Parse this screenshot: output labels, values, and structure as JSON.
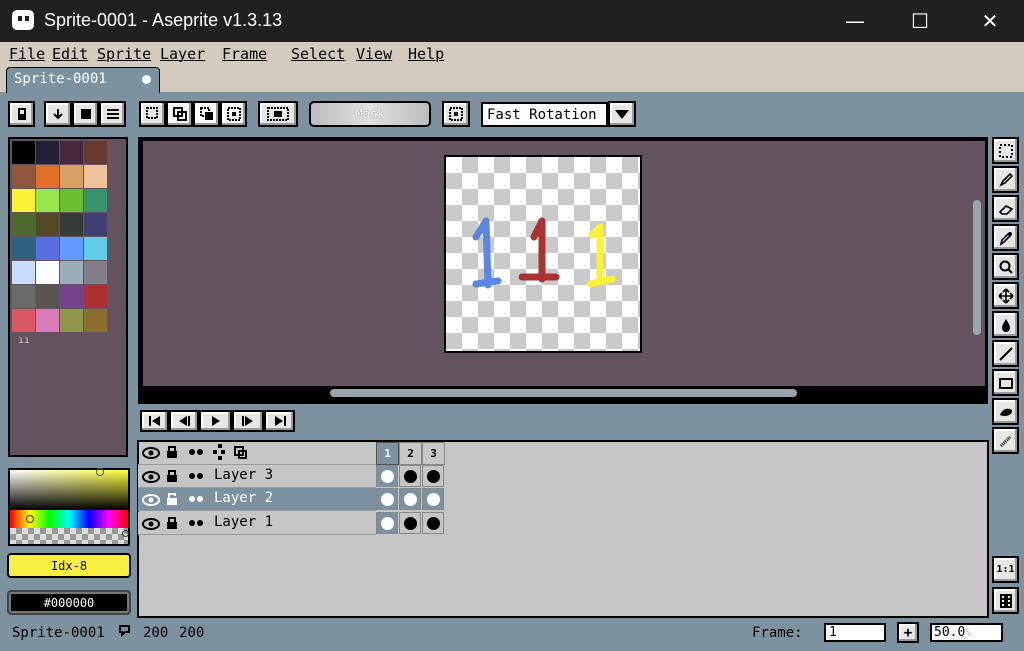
{
  "window": {
    "title": "Sprite-0001 - Aseprite v1.3.13",
    "minimize": "—",
    "maximize": "☐",
    "close": "✕"
  },
  "menu": [
    "File",
    "Edit",
    "Sprite",
    "Layer",
    "Frame",
    "Select",
    "View",
    "Help"
  ],
  "tab": {
    "label": "Sprite-0001"
  },
  "toolbar": {
    "mask_label": "Mask",
    "rotation_value": "Fast Rotation"
  },
  "palette": {
    "colors": [
      "#000000",
      "#222034",
      "#45283c",
      "#663931",
      "#8f563b",
      "#df7126",
      "#d9a066",
      "#eec39a",
      "#fbf236",
      "#99e550",
      "#6abe30",
      "#37946e",
      "#4b692f",
      "#524b24",
      "#323c39",
      "#3f3f74",
      "#306082",
      "#5b6ee1",
      "#639bff",
      "#5fcde4",
      "#cbdbfc",
      "#ffffff",
      "#9badb7",
      "#847e87",
      "#696a6a",
      "#595652",
      "#76428a",
      "#ac3232",
      "#d95763",
      "#d77bba",
      "#8f974a",
      "#8a6f30"
    ],
    "more_icon": "palette-resize-icon"
  },
  "colorbar": {
    "fg_label": "Idx-8",
    "bg_label": "#000000"
  },
  "timeline": {
    "frames": [
      "1",
      "2",
      "3"
    ],
    "layers": [
      {
        "name": "Layer 3",
        "selected": false
      },
      {
        "name": "Layer 2",
        "selected": true
      },
      {
        "name": "Layer 1",
        "selected": false
      }
    ]
  },
  "status": {
    "sprite_name": "Sprite-0001",
    "size_w": "200",
    "size_h": "200",
    "frame_label": "Frame:",
    "frame_value": "1",
    "zoom_value": "50.0",
    "zoom_unit": "%"
  },
  "zoom_reset": "1:1"
}
